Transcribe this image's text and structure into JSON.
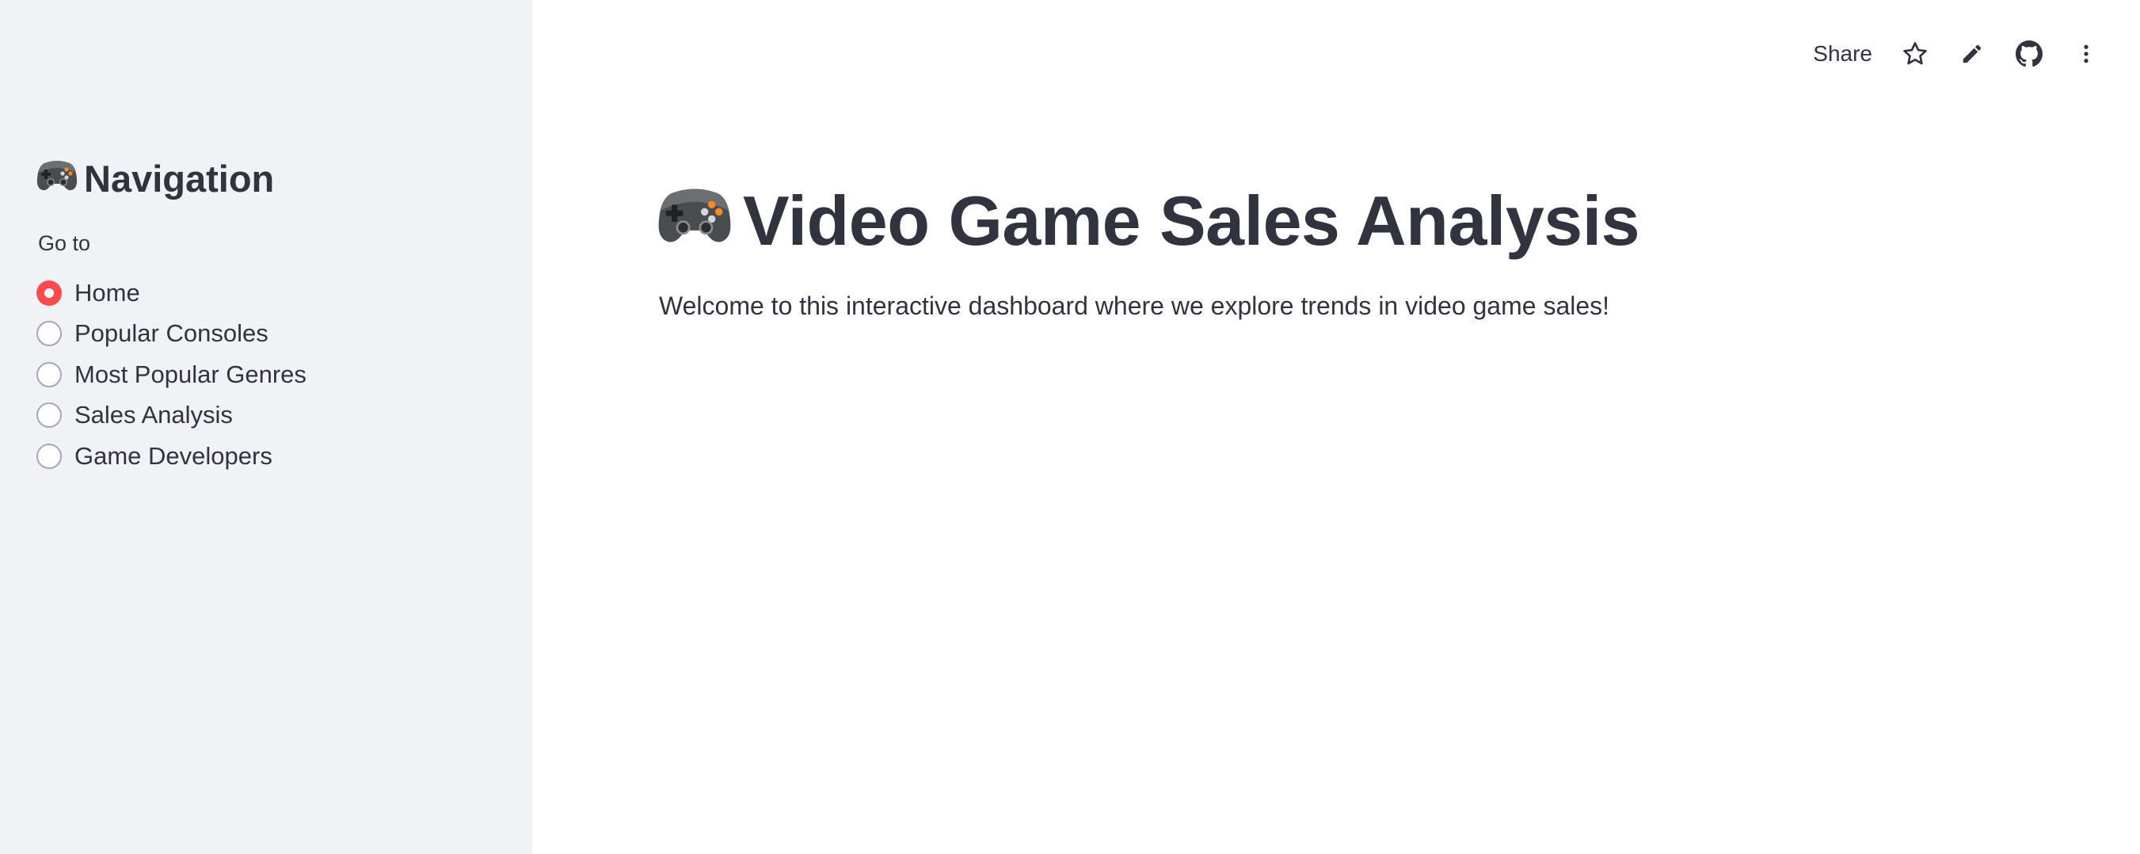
{
  "sidebar": {
    "title_icon": "video-game-controller-icon",
    "title": "Navigation",
    "radio_label": "Go to",
    "options": [
      {
        "label": "Home",
        "selected": true
      },
      {
        "label": "Popular Consoles",
        "selected": false
      },
      {
        "label": "Most Popular Genres",
        "selected": false
      },
      {
        "label": "Sales Analysis",
        "selected": false
      },
      {
        "label": "Game Developers",
        "selected": false
      }
    ]
  },
  "toolbar": {
    "share_label": "Share",
    "icons": [
      "star-icon",
      "pencil-icon",
      "github-icon",
      "more-vertical-icon"
    ]
  },
  "main": {
    "title_icon": "video-game-controller-icon",
    "title": "Video Game Sales Analysis",
    "subtitle": "Welcome to this interactive dashboard where we explore trends in video game sales!"
  },
  "colors": {
    "accent": "#ff4b4b",
    "sidebar_bg": "#f0f2f6",
    "text": "#31333f"
  }
}
